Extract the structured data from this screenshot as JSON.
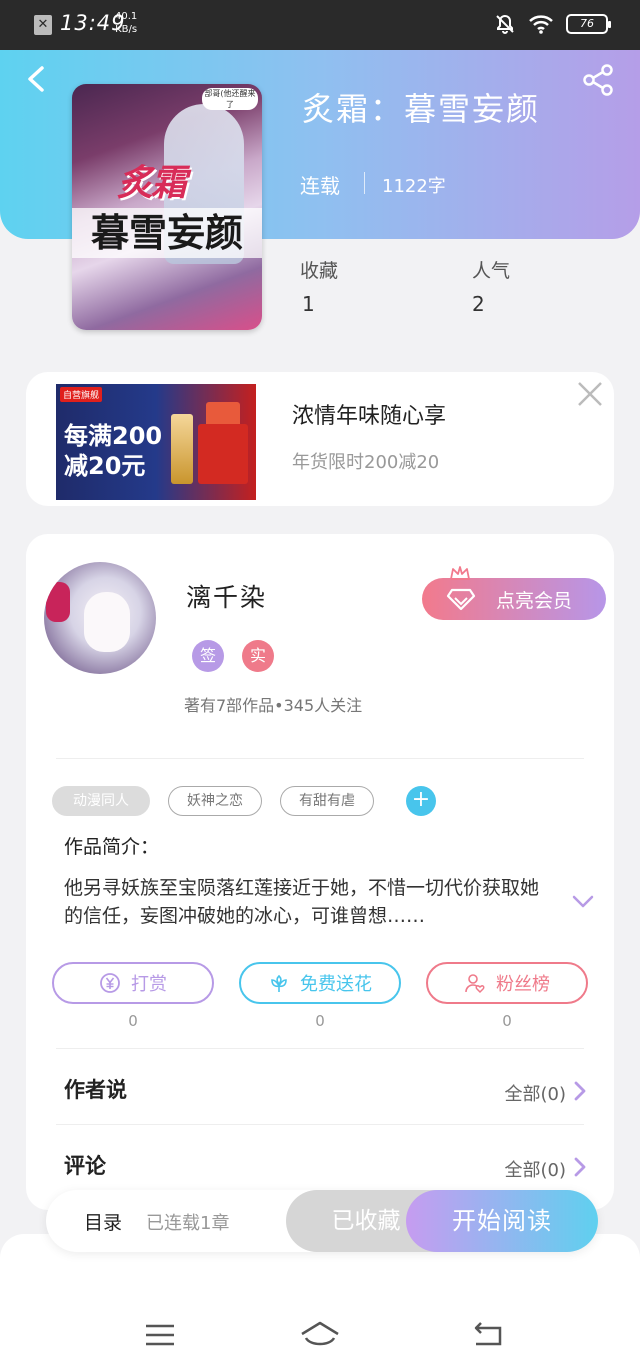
{
  "status_bar": {
    "time": "13:49",
    "speed_value": "40.1",
    "speed_unit": "KB/s",
    "battery": "76"
  },
  "book": {
    "title": "炙霜：暮雪妄颜",
    "status": "连载",
    "words": "1122字",
    "stats": [
      {
        "label": "收藏",
        "value": "1"
      },
      {
        "label": "人气",
        "value": "2"
      }
    ],
    "cover": {
      "red_text": "炙霜",
      "title_text": "暮雪妄颜",
      "bubble_text": "部哥(他还醒来了"
    }
  },
  "ad": {
    "title": "浓情年味随心享",
    "subtitle": "年货限时200减20",
    "image_logo": "自营旗舰",
    "image_line1": "每满200",
    "image_line2": "减20元"
  },
  "author": {
    "name": "漓千染",
    "badges": [
      {
        "text": "签",
        "color": "#b79ae6"
      },
      {
        "text": "实",
        "color": "#ef7a8a"
      }
    ],
    "info": "著有7部作品•345人关注",
    "vip_button": "点亮会员"
  },
  "tags": [
    "动漫同人",
    "妖神之恋",
    "有甜有虐"
  ],
  "intro": {
    "label": "作品简介：",
    "text": "他另寻妖族至宝陨落红莲接近于她，不惜一切代价获取她的信任，妄图冲破她的冰心，可谁曾想……"
  },
  "actions": [
    {
      "label": "打赏",
      "count": "0",
      "color": "#b79ae6"
    },
    {
      "label": "免费送花",
      "count": "0",
      "color": "#48c5ec"
    },
    {
      "label": "粉丝榜",
      "count": "0",
      "color": "#ef7a8a"
    }
  ],
  "rows": [
    {
      "label": "作者说",
      "value": "全部(0)"
    },
    {
      "label": "评论",
      "value": "全部(0)"
    }
  ],
  "bottom_bar": {
    "toc_label": "目录",
    "toc_sub": "已连载1章",
    "collected": "已收藏",
    "read": "开始阅读"
  }
}
